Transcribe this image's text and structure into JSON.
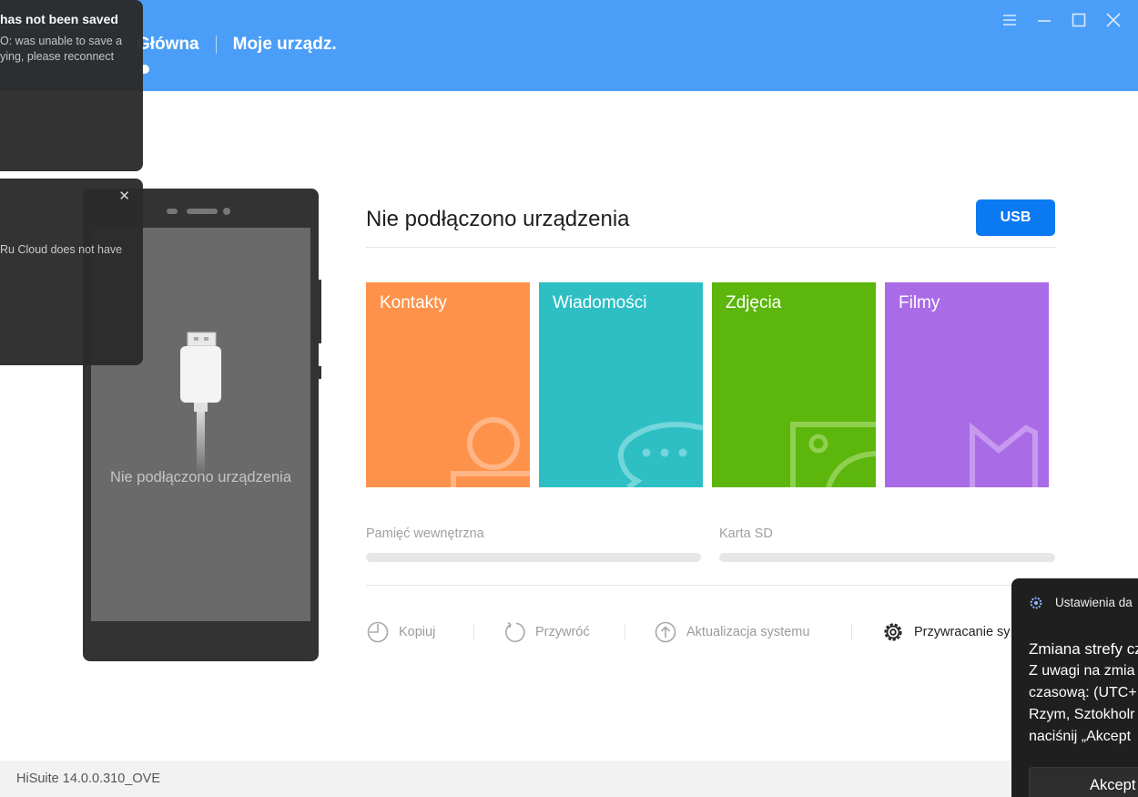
{
  "header": {
    "nav_home": "Główna",
    "nav_devices": "Moje urządz."
  },
  "notifications": [
    {
      "title": "has not been saved",
      "lines": [
        "O: was unable to save a",
        "ying, please reconnect"
      ]
    },
    {
      "lines": [
        "Ru Cloud does not have"
      ]
    }
  ],
  "phone": {
    "label": "Nie podłączono urządzenia"
  },
  "main": {
    "title": "Nie podłączono urządzenia",
    "usb_button": "USB",
    "tiles": [
      {
        "label": "Kontakty",
        "color": "#ff924a"
      },
      {
        "label": "Wiadomości",
        "color": "#2ebfc4"
      },
      {
        "label": "Zdjęcia",
        "color": "#5cb60b"
      },
      {
        "label": "Filmy",
        "color": "#aa6be6"
      }
    ],
    "storage": {
      "internal": "Pamięć wewnętrzna",
      "sd": "Karta SD"
    },
    "actions": {
      "backup": "Kopiuj",
      "restore": "Przywróć",
      "update": "Aktualizacja systemu",
      "recovery": "Przywracanie sy"
    }
  },
  "footer": {
    "version": "HiSuite 14.0.0.310_OVE"
  },
  "toast": {
    "app": "Ustawienia da",
    "title": "Zmiana strefy cz",
    "lines": [
      "Z uwagi na zmia",
      "czasową: (UTC+",
      "Rzym, Sztokholr",
      "naciśnij „Akcept"
    ],
    "accept_button": "Akcept"
  },
  "colors": {
    "header": "#4b9ef7",
    "usb": "#0b7af2"
  }
}
